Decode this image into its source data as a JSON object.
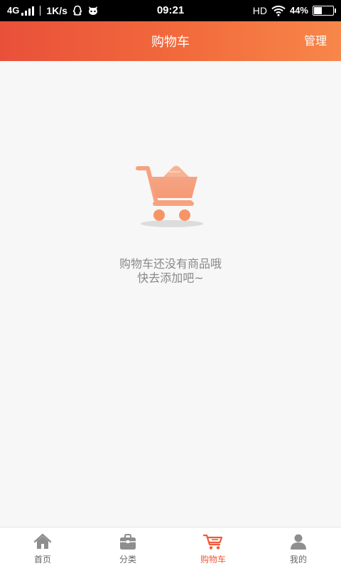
{
  "status_bar": {
    "network": "4G",
    "speed": "1K/s",
    "time": "09:21",
    "hd": "HD",
    "battery": "44%",
    "battery_level": 0.44
  },
  "header": {
    "title": "购物车",
    "manage_label": "管理"
  },
  "empty_state": {
    "line1": "购物车还没有商品哦",
    "line2": "快去添加吧~",
    "icon": "shopping-cart-icon"
  },
  "bottom_nav": {
    "items": [
      {
        "label": "首页",
        "icon": "home-icon",
        "active": false
      },
      {
        "label": "分类",
        "icon": "bag-icon",
        "active": false
      },
      {
        "label": "购物车",
        "icon": "cart-icon",
        "active": true
      },
      {
        "label": "我的",
        "icon": "user-icon",
        "active": false
      }
    ]
  },
  "colors": {
    "accent": "#f05a3a",
    "header_start": "#e9503a",
    "header_end": "#f7874a",
    "cart_illustration": "#f7a27f",
    "inactive_icon": "#8e8e8e"
  }
}
